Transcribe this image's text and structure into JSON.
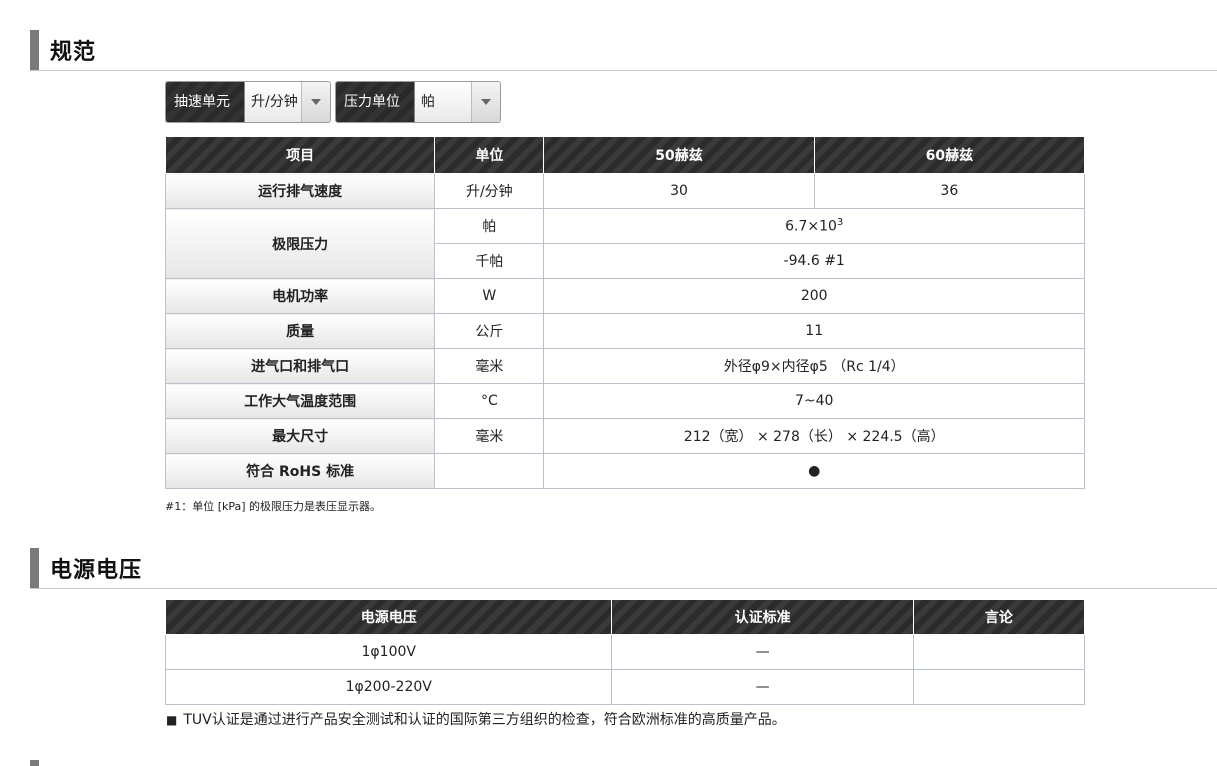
{
  "sections": {
    "spec_title": "规范",
    "power_title": "电源电压"
  },
  "selectors": {
    "speed": {
      "label": "抽速单元",
      "value": "升/分钟"
    },
    "pressure": {
      "label": "压力单位",
      "value": "帕"
    }
  },
  "spec_table": {
    "headers": [
      "项目",
      "单位",
      "50赫兹",
      "60赫兹"
    ],
    "rows": {
      "pumping_speed": {
        "item": "运行排气速度",
        "unit": "升/分钟",
        "v50": "30",
        "v60": "36"
      },
      "ultimate_pressure": {
        "item": "极限压力",
        "unit_pa": "帕",
        "value_pa_base": "6.7×10",
        "value_pa_exp": "3",
        "unit_kpa": "千帕",
        "value_kpa": "-94.6 #1"
      },
      "motor_power": {
        "item": "电机功率",
        "unit": "W",
        "value": "200"
      },
      "mass": {
        "item": "质量",
        "unit": "公斤",
        "value": "11"
      },
      "ports": {
        "item": "进气口和排气口",
        "unit": "毫米",
        "value": "外径φ9×内径φ5 （Rc 1/4）"
      },
      "temp_range": {
        "item": "工作大气温度范围",
        "unit": "°C",
        "value": "7~40"
      },
      "max_size": {
        "item": "最大尺寸",
        "unit": "毫米",
        "value": "212（宽） × 278（长） × 224.5（高）"
      },
      "rohs": {
        "item": "符合 RoHS 标准",
        "unit": "",
        "value": "●"
      }
    },
    "footnote": "#1：单位 [kPa] 的极限压力是表压显示器。"
  },
  "power_table": {
    "headers": [
      "电源电压",
      "认证标准",
      "言论"
    ],
    "rows": [
      {
        "voltage": "1φ100V",
        "cert": "—",
        "remark": ""
      },
      {
        "voltage": "1φ200-220V",
        "cert": "—",
        "remark": ""
      }
    ],
    "note_marker": "■",
    "note": "TUV认证是通过进行产品安全测试和认证的国际第三方组织的检查，符合欧洲标准的高质量产品。"
  }
}
